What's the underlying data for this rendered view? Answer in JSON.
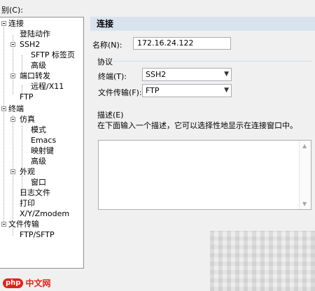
{
  "category_label": "别(C):",
  "tree": {
    "connection": "连接",
    "login_actions": "登陆动作",
    "ssh2": "SSH2",
    "sftp_tab": "SFTP 标签页",
    "advanced_ssh": "高级",
    "port_forwarding": "端口转发",
    "remote_x11": "远程/X11",
    "ftp": "FTP",
    "terminal": "终端",
    "emulation": "仿真",
    "modes": "模式",
    "emacs": "Emacs",
    "mapped_keys": "映射键",
    "advanced_emu": "高级",
    "appearance": "外观",
    "window": "窗口",
    "log_file": "日志文件",
    "printing": "打印",
    "xyzmodem": "X/Y/Zmodem",
    "file_transfer": "文件传输",
    "ftp_sftp": "FTP/SFTP"
  },
  "panel": {
    "title": "连接",
    "name_label": "名称(N):",
    "name_value": "172.16.24.122",
    "protocol_group": "协议",
    "terminal_label": "终端(T):",
    "terminal_value": "SSH2",
    "file_transfer_label": "文件传输(F):",
    "file_transfer_value": "FTP",
    "description_label": "描述(E)",
    "description_hint": "在下面输入一个描述，它可以选择性地显示在连接窗口中。"
  },
  "watermark": {
    "logo": "php",
    "text": "中文网"
  }
}
